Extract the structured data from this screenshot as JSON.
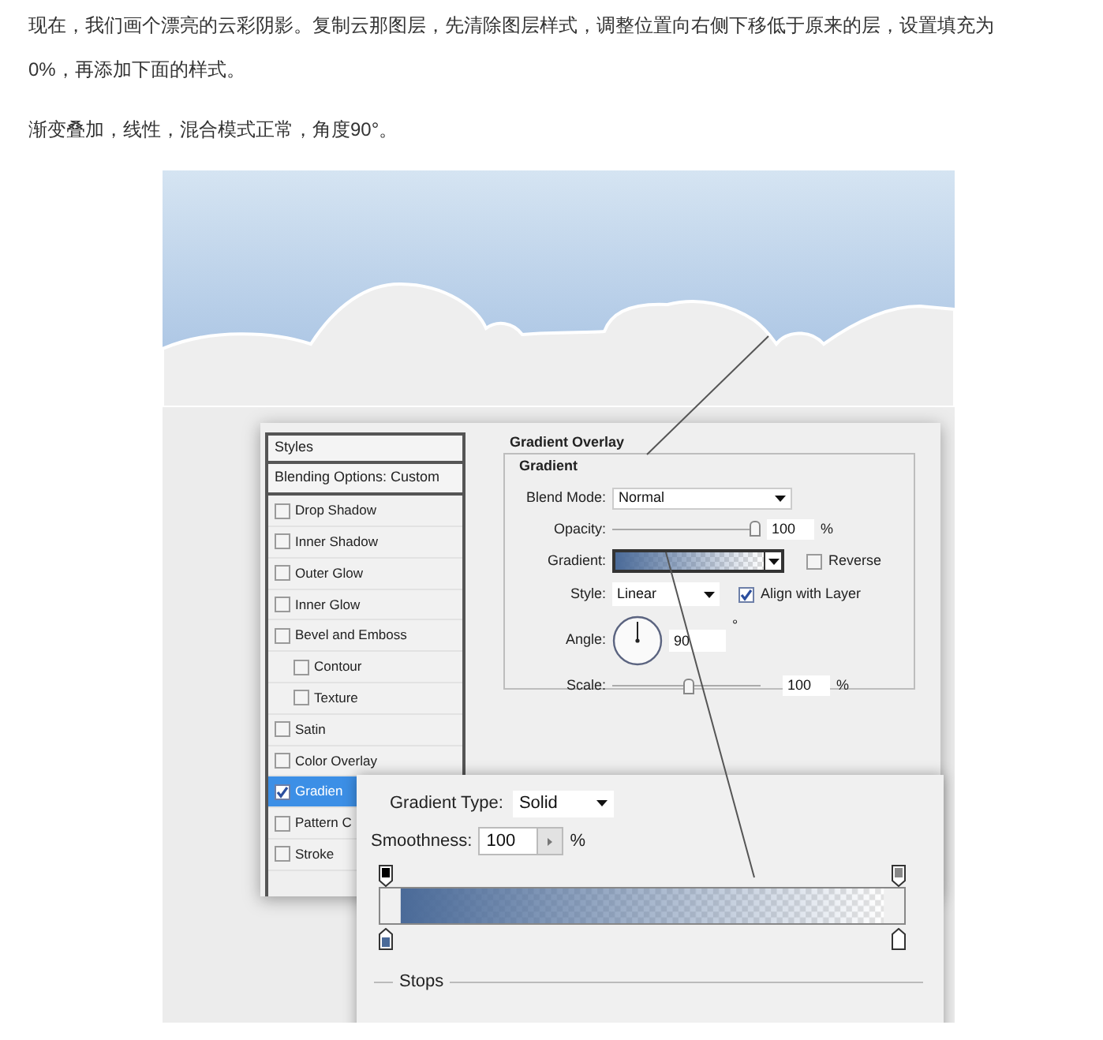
{
  "article": {
    "paragraphs": [
      "现在，我们画个漂亮的云彩阴影。复制云那图层，先清除图层样式，调整位置向右侧下移低于原来的层，设置填充为0%，再添加下面的样式。",
      "渐变叠加，线性，混合模式正常，角度90°。"
    ]
  },
  "figure": {
    "styles_panel": {
      "header": "Styles",
      "blending_options": "Blending Options: Custom",
      "items": [
        {
          "label": "Drop Shadow",
          "checked": false,
          "selected": false
        },
        {
          "label": "Inner Shadow",
          "checked": false,
          "selected": false
        },
        {
          "label": "Outer Glow",
          "checked": false,
          "selected": false
        },
        {
          "label": "Inner Glow",
          "checked": false,
          "selected": false
        },
        {
          "label": "Bevel and Emboss",
          "checked": false,
          "selected": false,
          "children": [
            {
              "label": "Contour",
              "checked": false,
              "selected": false
            },
            {
              "label": "Texture",
              "checked": false,
              "selected": false
            }
          ]
        },
        {
          "label": "Satin",
          "checked": false,
          "selected": false
        },
        {
          "label": "Color Overlay",
          "checked": false,
          "selected": false
        },
        {
          "label": "Gradien",
          "checked": true,
          "selected": true
        },
        {
          "label": "Pattern C",
          "checked": false,
          "selected": false
        },
        {
          "label": "Stroke",
          "checked": false,
          "selected": false
        }
      ]
    },
    "gradient_overlay": {
      "title": "Gradient Overlay",
      "group": "Gradient",
      "blend_mode": {
        "label": "Blend Mode:",
        "value": "Normal"
      },
      "opacity": {
        "label": "Opacity:",
        "level": 1,
        "value": "100",
        "unit": "%"
      },
      "gradient": {
        "label": "Gradient:"
      },
      "reverse": {
        "label": "Reverse",
        "checked": false
      },
      "style": {
        "label": "Style:",
        "value": "Linear"
      },
      "align_with_layer": {
        "label": "Align with Layer",
        "checked": true
      },
      "angle": {
        "label": "Angle:",
        "value": "90",
        "unit": "°"
      },
      "scale": {
        "label": "Scale:",
        "level": 0.52,
        "value": "100",
        "unit": "%"
      }
    },
    "gradient_editor": {
      "type_label": "Gradient Type:",
      "type_value": "Solid",
      "smoothness_label": "Smoothness:",
      "smoothness_value": "100",
      "smoothness_unit": "%",
      "stops_label": "Stops"
    }
  }
}
